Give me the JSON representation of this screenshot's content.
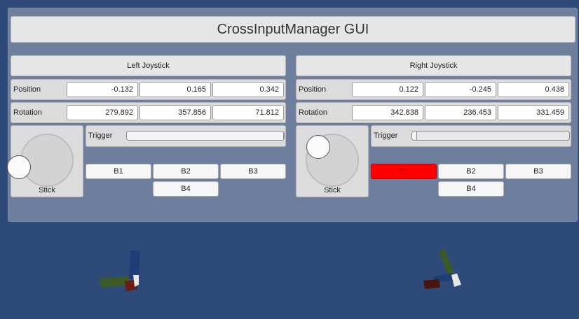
{
  "title": "CrossInputManager GUI",
  "left": {
    "header": "Left Joystick",
    "position_label": "Position",
    "position": [
      "-0.132",
      "0.165",
      "0.342"
    ],
    "rotation_label": "Rotation",
    "rotation": [
      "279.892",
      "357.856",
      "71.812"
    ],
    "stick_label": "Stick",
    "trigger_label": "Trigger",
    "trigger_value": 1.0,
    "buttons": [
      "B1",
      "B2",
      "B3",
      "B4"
    ],
    "pressed": []
  },
  "right": {
    "header": "Right Joystick",
    "position_label": "Position",
    "position": [
      "0.122",
      "-0.245",
      "0.438"
    ],
    "rotation_label": "Rotation",
    "rotation": [
      "342.838",
      "236.453",
      "331.459"
    ],
    "stick_label": "Stick",
    "trigger_label": "Trigger",
    "trigger_value": 0.03,
    "buttons": [
      "B1",
      "B2",
      "B3",
      "B4"
    ],
    "pressed": [
      "B1"
    ]
  },
  "colors": {
    "background": "#2e4a78",
    "window": "#6d7f9c",
    "pressed_button": "#ff0000",
    "axis_x": "#6e1c16",
    "axis_y": "#3b5a24",
    "axis_z": "#1f3e78"
  },
  "icons": {
    "left_gizmo": "axis-gizmo-icon",
    "right_gizmo": "axis-gizmo-icon"
  }
}
